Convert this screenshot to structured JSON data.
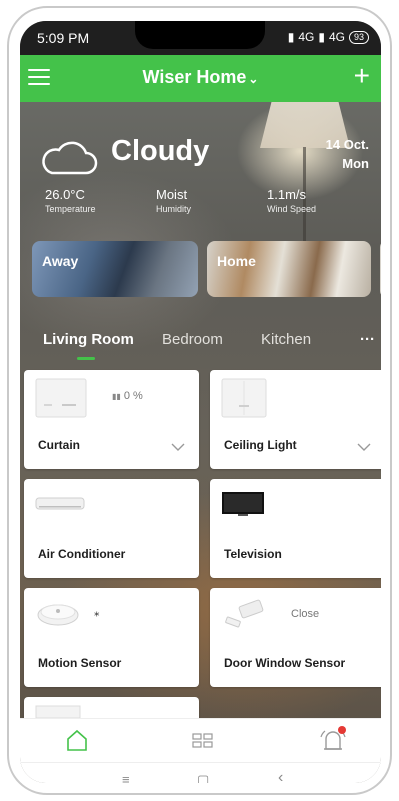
{
  "status_bar": {
    "time": "5:09 PM",
    "network": "4G",
    "network2": "4G",
    "battery": "93"
  },
  "header": {
    "title": "Wiser Home",
    "menu_icon": "hamburger-menu-icon",
    "add_icon": "plus-icon"
  },
  "weather": {
    "condition": "Cloudy",
    "date_day": "14 Oct.",
    "date_weekday": "Mon",
    "stats": [
      {
        "value": "26.0°C",
        "label": "Temperature"
      },
      {
        "value": "Moist",
        "label": "Humidity"
      },
      {
        "value": "1.1m/s",
        "label": "Wind Speed"
      }
    ]
  },
  "scenes": [
    {
      "label": "Away"
    },
    {
      "label": "Home"
    }
  ],
  "rooms": {
    "tabs": [
      "Living Room",
      "Bedroom",
      "Kitchen"
    ],
    "more": "···"
  },
  "devices": [
    {
      "name": "Curtain",
      "status": "0 %"
    },
    {
      "name": "Ceiling Light"
    },
    {
      "name": "Air Conditioner"
    },
    {
      "name": "Television"
    },
    {
      "name": "Motion Sensor"
    },
    {
      "name": "Door Window Sensor",
      "status": "Close"
    }
  ],
  "colors": {
    "accent": "#44c24a",
    "notification": "#e53935"
  },
  "bottom_nav": {
    "icons": [
      "home-icon",
      "devices-grid-icon",
      "alarm-bell-icon"
    ]
  },
  "system_nav": {
    "menu": "≡",
    "home": "▢",
    "back": "‹"
  }
}
